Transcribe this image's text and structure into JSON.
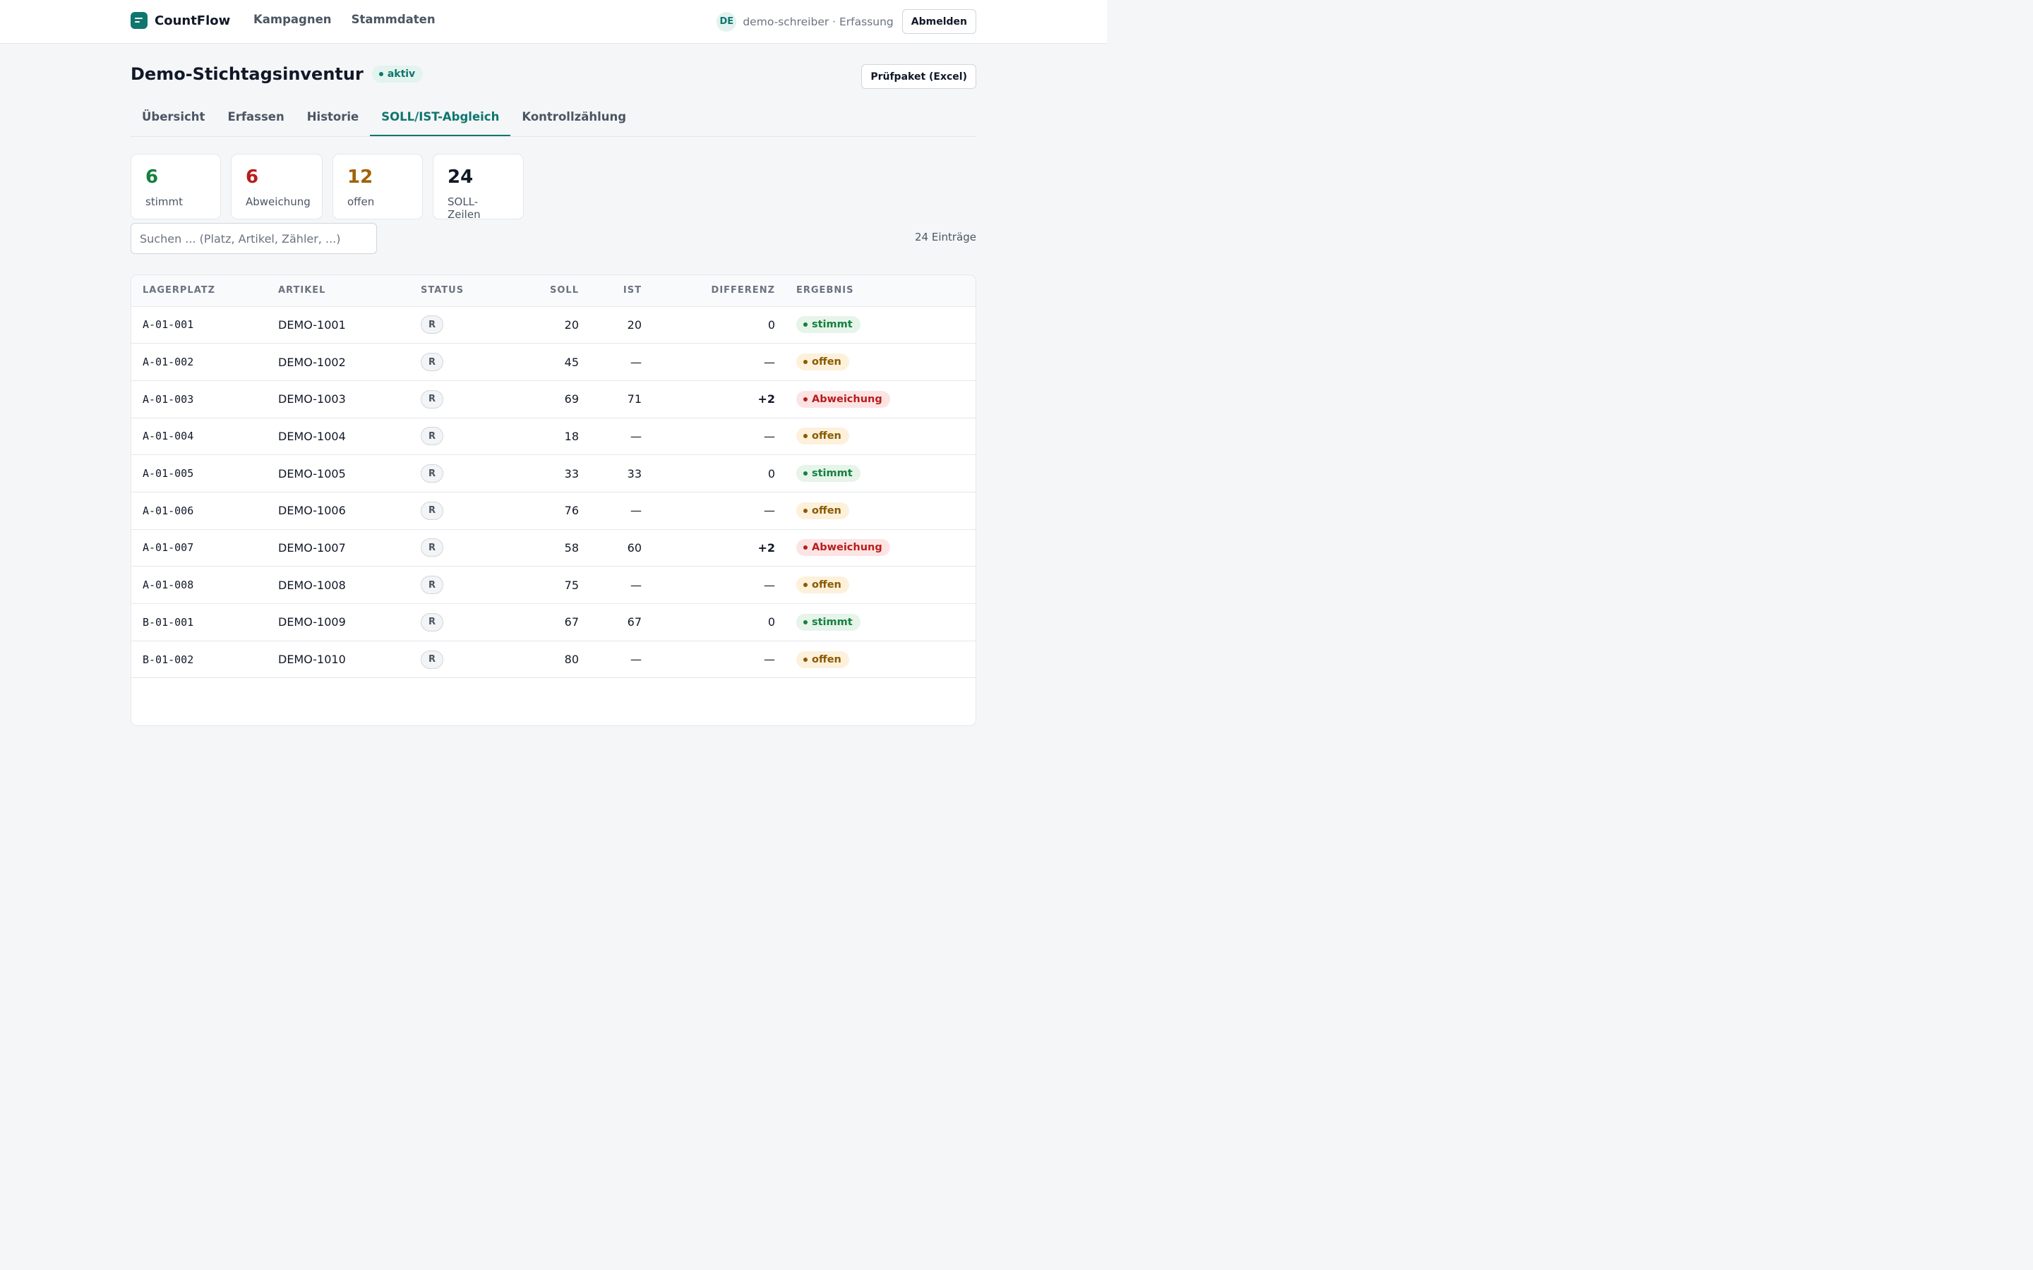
{
  "app": {
    "name": "CountFlow"
  },
  "nav": {
    "items": [
      "Kampagnen",
      "Stammdaten"
    ]
  },
  "user": {
    "initials": "DE",
    "text": "demo-schreiber · Erfassung",
    "logout_label": "Abmelden"
  },
  "page": {
    "title": "Demo-Stichtagsinventur",
    "status_badge": "aktiv",
    "export_label": "Prüfpaket (Excel)"
  },
  "tabs": [
    {
      "label": "Übersicht",
      "active": false
    },
    {
      "label": "Erfassen",
      "active": false
    },
    {
      "label": "Historie",
      "active": false
    },
    {
      "label": "SOLL/IST-Abgleich",
      "active": true
    },
    {
      "label": "Kontrollzählung",
      "active": false
    }
  ],
  "stats": [
    {
      "value": "6",
      "label": "stimmt",
      "color": "#15803d"
    },
    {
      "value": "6",
      "label": "Abweichung",
      "color": "#b91c1c"
    },
    {
      "value": "12",
      "label": "offen",
      "color": "#a16207"
    },
    {
      "value": "24",
      "label": "SOLL-Zeilen",
      "color": "#111827"
    }
  ],
  "search": {
    "placeholder": "Suchen ... (Platz, Artikel, Zähler, ...)"
  },
  "entries_label": "24 Einträge",
  "table": {
    "headers": {
      "lagerplatz": "LAGERPLATZ",
      "artikel": "ARTIKEL",
      "status": "STATUS",
      "soll": "SOLL",
      "ist": "IST",
      "differenz": "DIFFERENZ",
      "ergebnis": "ERGEBNIS"
    },
    "rows": [
      {
        "lagerplatz": "A-01-001",
        "artikel": "DEMO-1001",
        "status": "R",
        "soll": "20",
        "ist": "20",
        "differenz": "0",
        "ergebnis": "stimmt"
      },
      {
        "lagerplatz": "A-01-002",
        "artikel": "DEMO-1002",
        "status": "R",
        "soll": "45",
        "ist": "—",
        "differenz": "—",
        "ergebnis": "offen"
      },
      {
        "lagerplatz": "A-01-003",
        "artikel": "DEMO-1003",
        "status": "R",
        "soll": "69",
        "ist": "71",
        "differenz": "+2",
        "ergebnis": "Abweichung"
      },
      {
        "lagerplatz": "A-01-004",
        "artikel": "DEMO-1004",
        "status": "R",
        "soll": "18",
        "ist": "—",
        "differenz": "—",
        "ergebnis": "offen"
      },
      {
        "lagerplatz": "A-01-005",
        "artikel": "DEMO-1005",
        "status": "R",
        "soll": "33",
        "ist": "33",
        "differenz": "0",
        "ergebnis": "stimmt"
      },
      {
        "lagerplatz": "A-01-006",
        "artikel": "DEMO-1006",
        "status": "R",
        "soll": "76",
        "ist": "—",
        "differenz": "—",
        "ergebnis": "offen"
      },
      {
        "lagerplatz": "A-01-007",
        "artikel": "DEMO-1007",
        "status": "R",
        "soll": "58",
        "ist": "60",
        "differenz": "+2",
        "ergebnis": "Abweichung"
      },
      {
        "lagerplatz": "A-01-008",
        "artikel": "DEMO-1008",
        "status": "R",
        "soll": "75",
        "ist": "—",
        "differenz": "—",
        "ergebnis": "offen"
      },
      {
        "lagerplatz": "B-01-001",
        "artikel": "DEMO-1009",
        "status": "R",
        "soll": "67",
        "ist": "67",
        "differenz": "0",
        "ergebnis": "stimmt"
      },
      {
        "lagerplatz": "B-01-002",
        "artikel": "DEMO-1010",
        "status": "R",
        "soll": "80",
        "ist": "—",
        "differenz": "—",
        "ergebnis": "offen"
      }
    ]
  }
}
